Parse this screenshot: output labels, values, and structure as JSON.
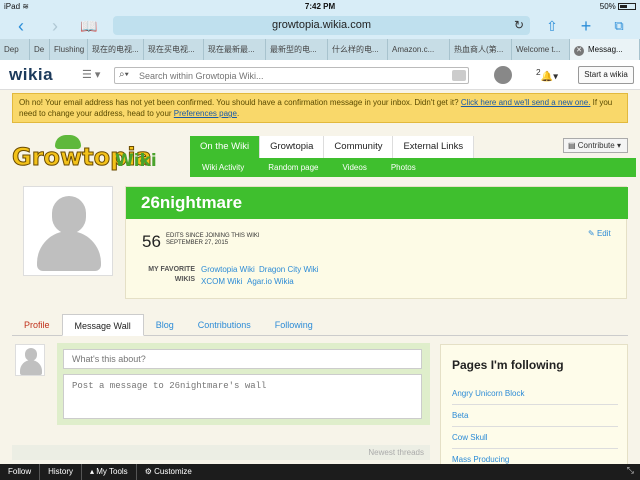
{
  "status": {
    "device": "iPad",
    "wifi_icon": "wifi-icon",
    "time": "7:42 PM",
    "battery": "50%"
  },
  "browser": {
    "url": "growtopia.wikia.com",
    "tabs": [
      "Dep",
      "De",
      "Flushing",
      "现在的电视...",
      "现在买电视...",
      "现在最新最...",
      "最新型的电...",
      "什么样的电...",
      "Amazon.c...",
      "热血商人(第...",
      "Welcome t...",
      "Messag..."
    ]
  },
  "wikia_bar": {
    "logo": "wikia",
    "search_placeholder": "Search within Growtopia Wiki...",
    "notifications_count": "2",
    "start_label": "Start a wikia"
  },
  "banner": {
    "text_1": "Oh no! Your email address has not yet been confirmed. You should have a confirmation message in your inbox. Didn't get it?",
    "link_1": "Click here and we'll send a new one.",
    "text_2": "If you need to change your address, head to your",
    "link_2": "Preferences page",
    "text_3": "."
  },
  "wiki": {
    "logo_main": "Growtopia",
    "logo_wiki": "Wiki",
    "nav_tabs": [
      "On the Wiki",
      "Growtopia",
      "Community",
      "External Links"
    ],
    "sub_nav": [
      "Wiki Activity",
      "Random page",
      "Videos",
      "Photos"
    ],
    "contribute": "Contribute"
  },
  "profile": {
    "username": "26nightmare",
    "edits_count": "56",
    "edits_label_1": "EDITS SINCE JOINING THIS WIKI",
    "edits_label_2": "SEPTEMBER 27, 2015",
    "edit_label": "Edit",
    "favorite_label_1": "MY FAVORITE",
    "favorite_label_2": "WIKIS",
    "favorites": [
      "Growtopia Wiki",
      "Dragon City Wiki",
      "XCOM Wiki",
      "Agar.io Wikia"
    ],
    "tabs": [
      "Profile",
      "Message Wall",
      "Blog",
      "Contributions",
      "Following"
    ],
    "active_tab": "Message Wall"
  },
  "wall": {
    "subject_placeholder": "What's this about?",
    "message_placeholder": "Post a message to 26nightmare's wall",
    "newest_threads": "Newest threads"
  },
  "sidebar": {
    "title": "Pages I'm following",
    "pages": [
      "Angry Unicorn Block",
      "Beta",
      "Cow Skull",
      "Mass Producing"
    ]
  },
  "bottom_toolbar": {
    "items": [
      "Follow",
      "History",
      "My Tools",
      "Customize"
    ]
  },
  "colors": {
    "wiki_green": "#3fbf2e",
    "link_blue": "#2c8bd6",
    "banner_yellow": "#f9d86a"
  }
}
